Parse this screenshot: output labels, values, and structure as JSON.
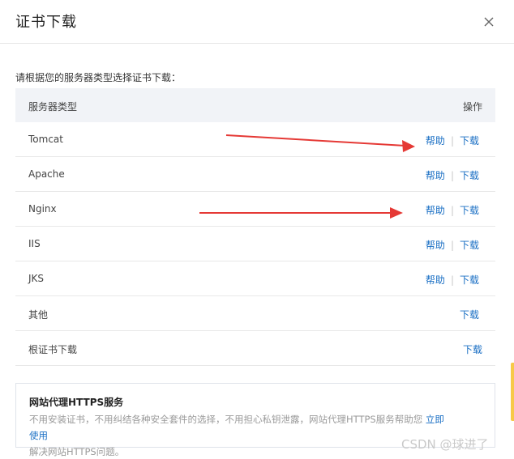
{
  "dialog": {
    "title": "证书下载"
  },
  "prompt": "请根据您的服务器类型选择证书下载：",
  "table": {
    "col_type": "服务器类型",
    "col_op": "操作",
    "rows": [
      {
        "name": "Tomcat",
        "help": "帮助",
        "sep": "|",
        "download": "下载"
      },
      {
        "name": "Apache",
        "help": "帮助",
        "sep": "|",
        "download": "下载"
      },
      {
        "name": "Nginx",
        "help": "帮助",
        "sep": "|",
        "download": "下载"
      },
      {
        "name": "IIS",
        "help": "帮助",
        "sep": "|",
        "download": "下载"
      },
      {
        "name": "JKS",
        "help": "帮助",
        "sep": "|",
        "download": "下载"
      },
      {
        "name": "其他",
        "download": "下载"
      },
      {
        "name": "根证书下载",
        "download": "下载"
      }
    ]
  },
  "promo": {
    "title": "网站代理HTTPS服务",
    "text_line1": "不用安装证书，不用纠结各种安全套件的选择，不用担心私钥泄露，网站代理HTTPS服务帮助您",
    "text_line2": "解决网站HTTPS问题。",
    "link": "立即使用"
  },
  "watermark": "CSDN @球进了",
  "colors": {
    "link": "#1a6fc4",
    "annotation_arrow": "#e53935",
    "side_tab": "#f7c948"
  },
  "icons": {
    "close": "close-icon"
  }
}
